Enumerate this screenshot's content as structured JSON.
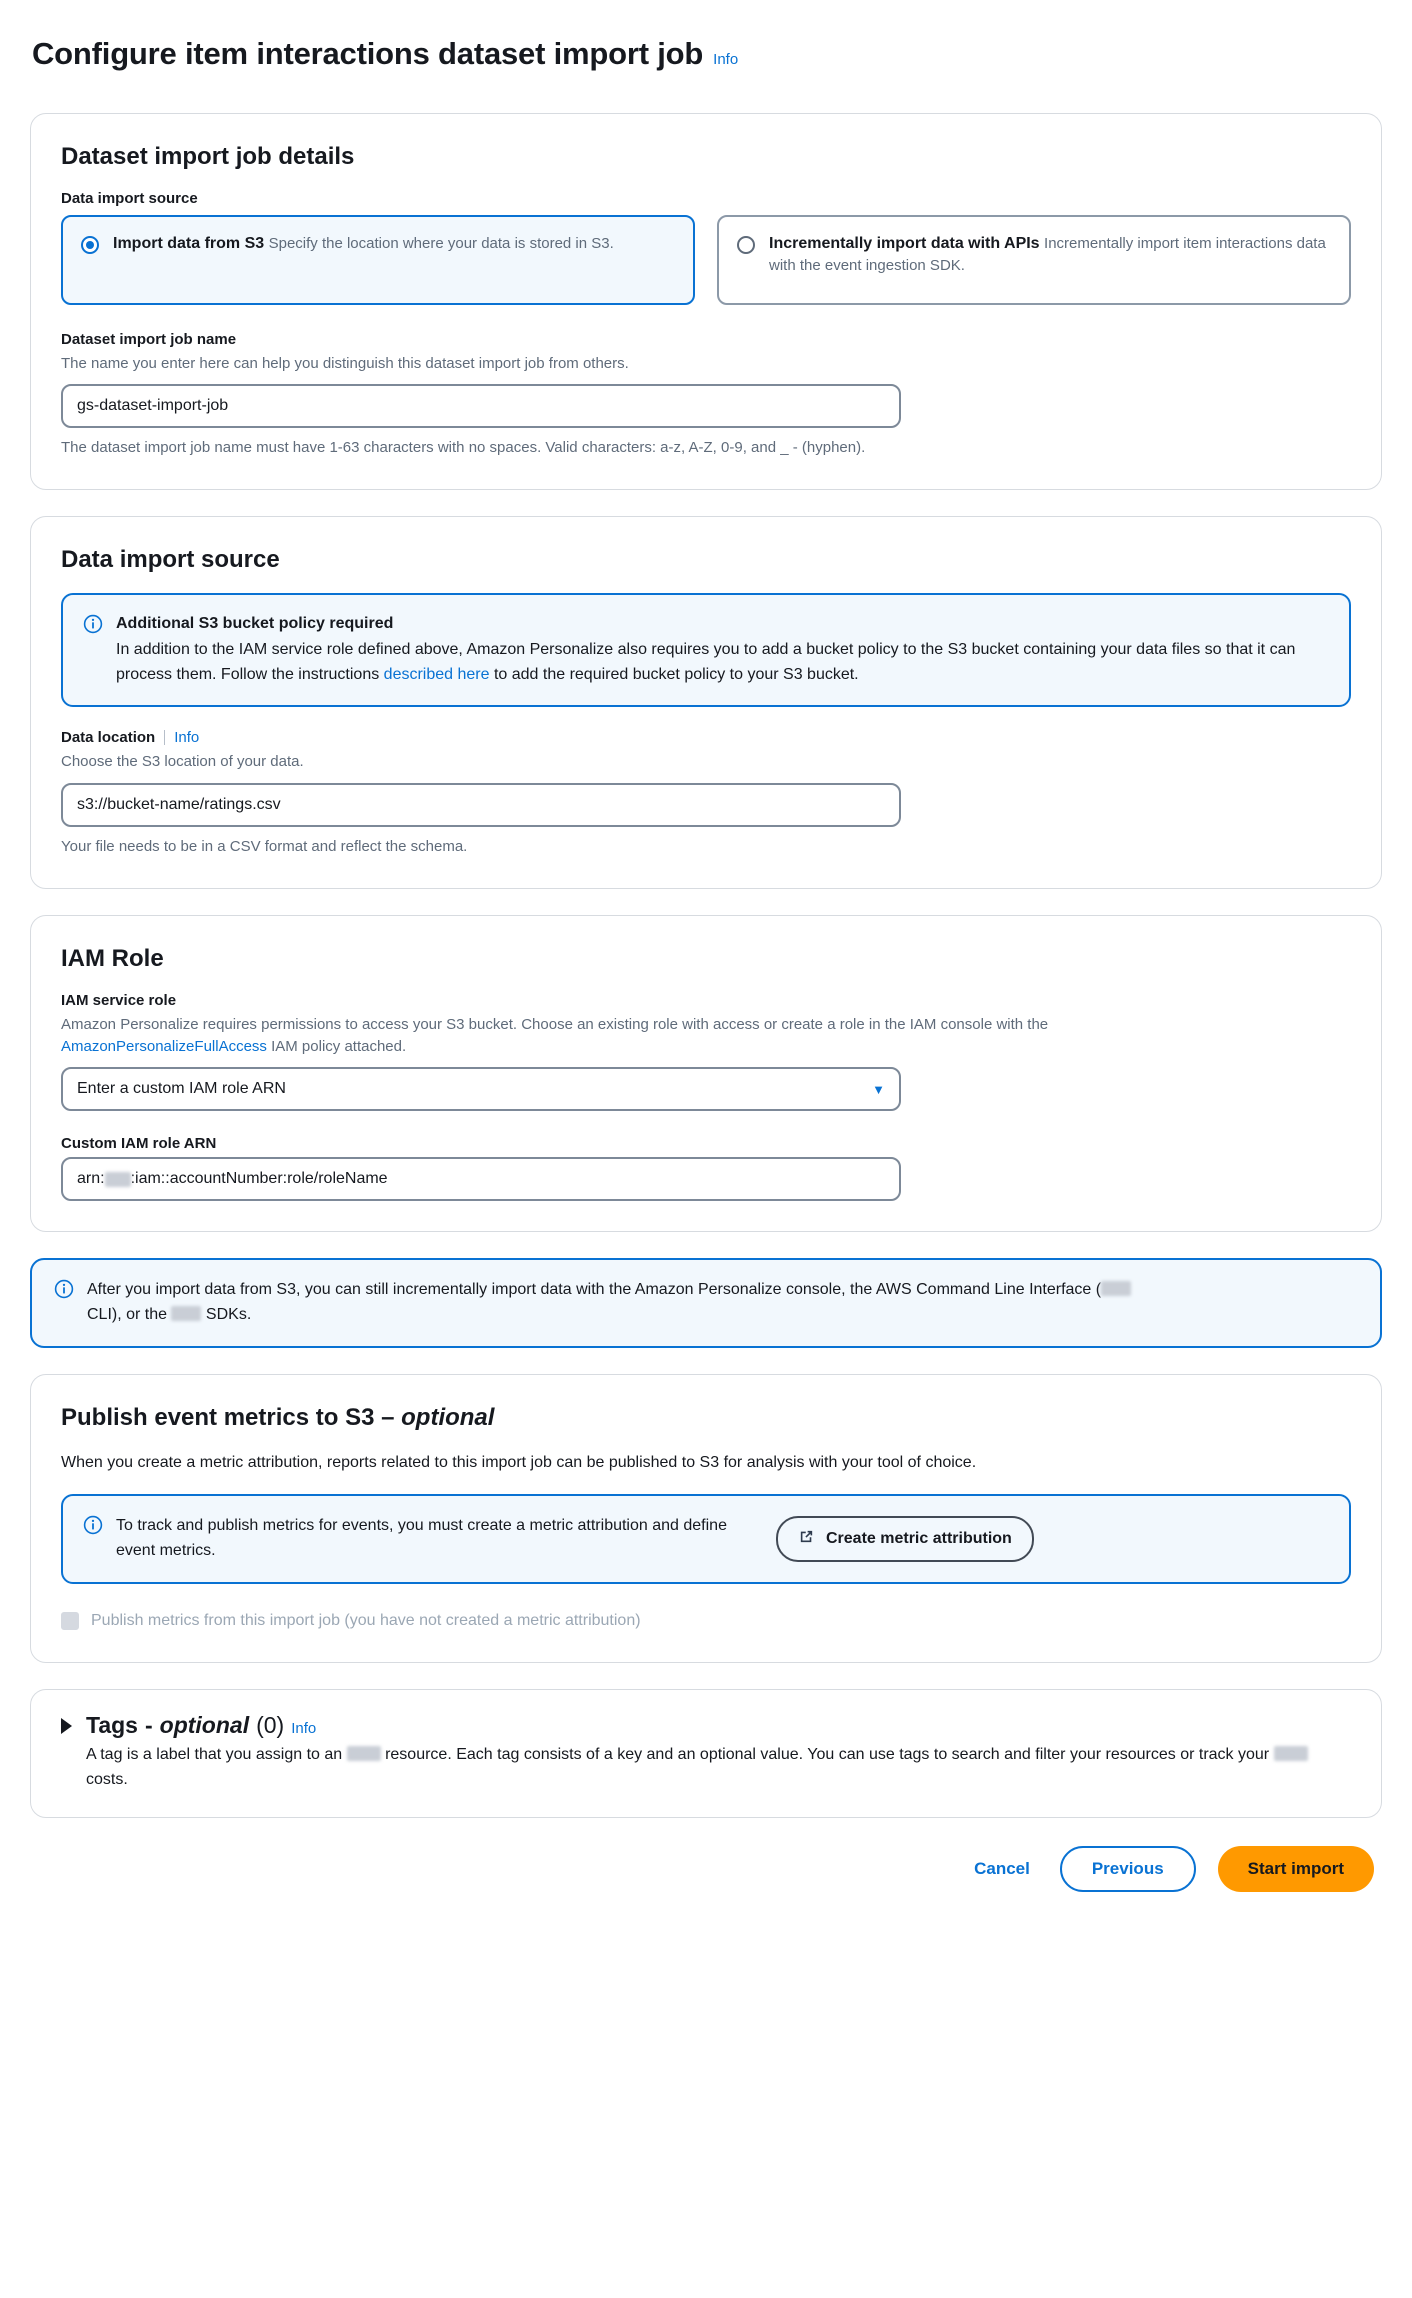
{
  "page": {
    "title": "Configure item interactions dataset import job",
    "info_label": "Info"
  },
  "details_card": {
    "title": "Dataset import job details",
    "data_import_source_label": "Data import source",
    "options": [
      {
        "title": "Import data from S3",
        "desc": "Specify the location where your data is stored in S3.",
        "selected": true
      },
      {
        "title": "Incrementally import data with APIs",
        "desc": "Incrementally import item interactions data with the event ingestion SDK.",
        "selected": false
      }
    ],
    "job_name_label": "Dataset import job name",
    "job_name_desc": "The name you enter here can help you distinguish this dataset import job from others.",
    "job_name_value": "gs-dataset-import-job",
    "job_name_hint": "The dataset import job name must have 1-63 characters with no spaces. Valid characters: a-z, A-Z, 0-9, and _ - (hyphen)."
  },
  "source_card": {
    "title": "Data import source",
    "alert": {
      "icon": "info-icon",
      "title": "Additional S3 bucket policy required",
      "text_before_link": "In addition to the IAM service role defined above, Amazon Personalize also requires you to add a bucket policy to the S3 bucket containing your data files so that it can process them. Follow the instructions ",
      "link_text": "described here",
      "text_after_link": " to add the required bucket policy to your S3 bucket."
    },
    "data_location_label": "Data location",
    "data_location_info": "Info",
    "data_location_desc": "Choose the S3 location of your data.",
    "data_location_value": "s3://bucket-name/ratings.csv",
    "data_location_hint": "Your file needs to be in a CSV format and reflect the schema."
  },
  "iam_card": {
    "title": "IAM Role",
    "service_role_label": "IAM service role",
    "service_role_desc_before_link": "Amazon Personalize requires permissions to access your S3 bucket. Choose an existing role with access or create a role in the IAM console with the ",
    "service_role_link": "AmazonPersonalizeFullAccess",
    "service_role_desc_after_link": " IAM policy attached.",
    "role_select_value": "Enter a custom IAM role ARN",
    "custom_arn_label": "Custom IAM role ARN",
    "custom_arn_prefix": "arn:",
    "custom_arn_suffix": ":iam::accountNumber:role/roleName"
  },
  "incremental_alert": {
    "icon": "info-icon",
    "part1": "After you import data from S3, you can still incrementally import data with the Amazon Personalize console, the AWS Command Line Interface (",
    "part2": " CLI), or the ",
    "part3": " SDKs."
  },
  "metrics_card": {
    "title_main": "Publish event metrics to S3",
    "title_dash": " – ",
    "title_optional": "optional",
    "desc": "When you create a metric attribution, reports related to this import job can be published to S3 for analysis with your tool of choice.",
    "alert": {
      "icon": "info-icon",
      "text": "To track and publish metrics for events, you must create a metric attribution and define event metrics."
    },
    "create_button_label": "Create metric attribution",
    "create_button_icon": "external-link-icon",
    "checkbox_label": "Publish metrics from this import job (you have not created a metric attribution)",
    "checkbox_checked": false
  },
  "tags_card": {
    "chevron_icon": "triangle-right-icon",
    "title": "Tags",
    "dash": " - ",
    "optional": "optional",
    "count": "(0)",
    "info_label": "Info",
    "desc_part1": "A tag is a label that you assign to an ",
    "desc_part2": " resource. Each tag consists of a key and an optional value. You can use tags to search and filter your resources or track your ",
    "desc_part3": " costs."
  },
  "footer": {
    "cancel_label": "Cancel",
    "previous_label": "Previous",
    "start_import_label": "Start import"
  },
  "colors": {
    "accent_blue": "#0972d3",
    "primary_orange": "#ff9900",
    "alert_bg": "#f2f8fd",
    "text": "#16191f",
    "muted": "#5f6b7a"
  }
}
